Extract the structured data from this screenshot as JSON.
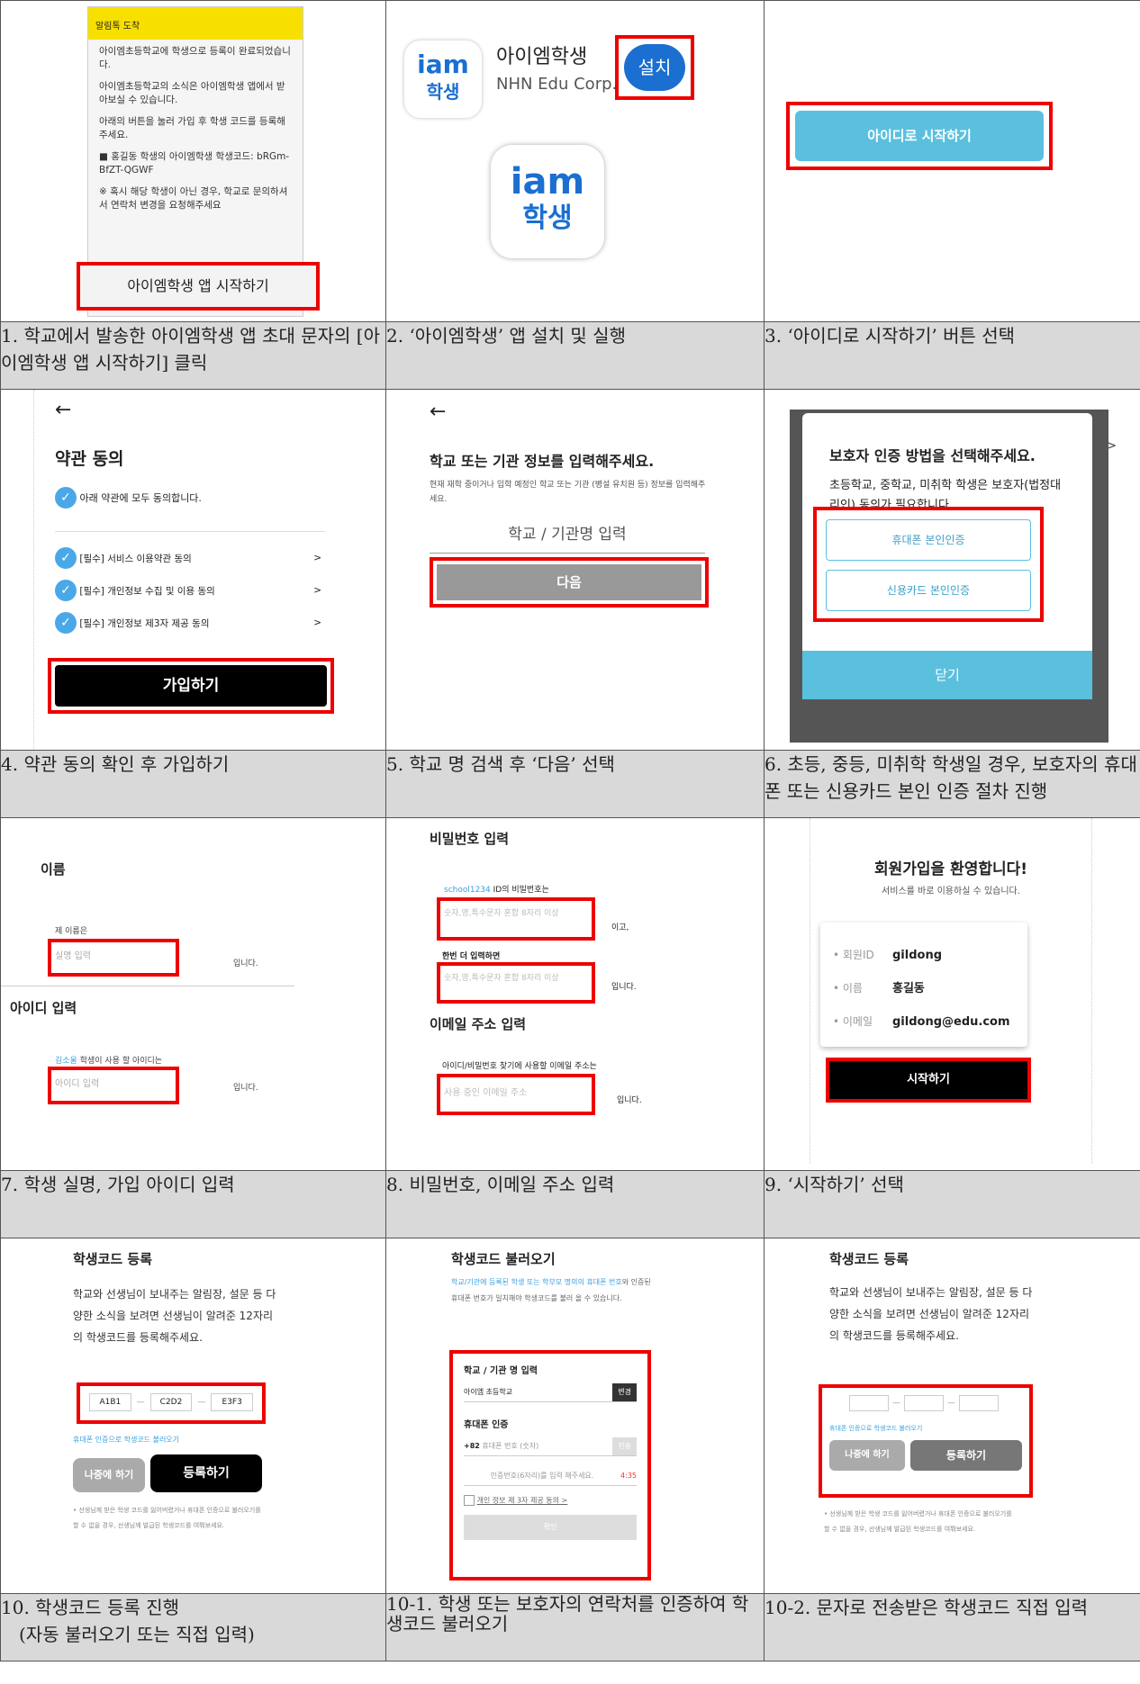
{
  "c1": {
    "header": "알림톡 도착",
    "p1": "아이엠초등학교에 학생으로 등록이 완료되었습니다.",
    "p2": "아이엠초등학교의 소식은 아이엠학생 앱에서 받아보실 수 있습니다.",
    "p3": "아래의 버튼을 눌러 가입 후 학생 코드를 등록해 주세요.",
    "p4": "■ 홍길동 학생의 아이엠학생 학생코드: bRGm-BfZT-QGWF",
    "p5": "※ 혹시 해당 학생이 아닌 경우, 학교로 문의하셔서 연락처 변경을 요청해주세요",
    "button": "아이엠학생 앱 시작하기"
  },
  "c2": {
    "logo_top": "iam",
    "logo_bottom": "학생",
    "app_name": "아이엠학생",
    "company": "NHN Edu Corp.",
    "install": "설치"
  },
  "c3": {
    "button": "아이디로 시작하기"
  },
  "cap1": {
    "c1": "1. 학교에서 발송한 아이엠학생 앱 초대 문자의 [아이엠학생 앱 시작하기] 클릭",
    "c2": "2. ‘아이엠학생’ 앱 설치 및 실행",
    "c3": "3. ‘아이디로 시작하기’ 버튼 선택"
  },
  "c4": {
    "back": "←",
    "title": "약관 동의",
    "all": "아래 약관에 모두 동의합니다.",
    "t1": "[필수] 서비스 이용약관 동의",
    "t2": "[필수] 개인정보 수집 및 이용 동의",
    "t3": "[필수] 개인정보 제3자 제공 동의",
    "chev": ">",
    "button": "가입하기"
  },
  "c5": {
    "back": "←",
    "title": "학교 또는 기관 정보를 입력해주세요.",
    "sub": "현재 재학 중이거나 입학 예정인 학교 또는 기관 (병설 유치원 등) 정보를 입력해주세요.",
    "input": "학교 / 기관명 입력",
    "button": "다음"
  },
  "c6": {
    "title": "보호자 인증 방법을 선택해주세요.",
    "sub": "초등학교, 중학교, 미취학 학생은 보호자(법정대리인) 동의가 필요합니다.",
    "phone": "휴대폰 본인인증",
    "card": "신용카드 본인인증",
    "close": "닫기",
    "chev": ">"
  },
  "cap2": {
    "c1": "4. 약관 동의 확인 후 가입하기",
    "c2": "5. 학교 명 검색 후 ‘다음’ 선택",
    "c3": "6. 초등, 중등, 미취학 학생일 경우, 보호자의 휴대폰 또는 신용카드 본인 인증 절차 진행"
  },
  "c7": {
    "name_title": "이름",
    "name_label": "제 이름은",
    "name_ph": "실명 입력",
    "suffix": "입니다.",
    "id_title": "아이디 입력",
    "id_label_name": "김소울",
    "id_label": " 학생이 사용 할 아이디는",
    "id_ph": "아이디 입력"
  },
  "c8": {
    "title": "비밀번호 입력",
    "id_hint_id": "school1234",
    "id_hint": " ID의 비밀번호는",
    "pw_ph": "숫자,영,특수문자 혼합 8자리 이상",
    "mid": "이고,",
    "again": "한번 더 입력하면",
    "suffix": "입니다.",
    "email_title": "이메일 주소 입력",
    "email_label": "아이디/비밀번호 찾기에 사용할 이메일 주소는",
    "email_ph": "사용 중인 이메일 주소"
  },
  "c9": {
    "title": "회원가입을 환영합니다!",
    "sub": "서비스를 바로 이용하실 수 있습니다.",
    "k1": "• 회원ID",
    "v1": "gildong",
    "k2": "• 이름",
    "v2": "홍길동",
    "k3": "• 이메일",
    "v3": "gildong@edu.com",
    "button": "시작하기"
  },
  "cap3": {
    "c1": "7. 학생 실명, 가입 아이디 입력",
    "c2": "8. 비밀번호, 이메일 주소 입력",
    "c3": "9. ‘시작하기’ 선택"
  },
  "c10": {
    "title": "학생코드 등록",
    "desc": "학교와 선생님이 보내주는 알림장, 설문 등 다양한 소식을 보려면 선생님이 알려준 12자리의 학생코드를 등록해주세요.",
    "code1": "A1B1",
    "code2": "C2D2",
    "code3": "E3F3",
    "dash": "—",
    "link": "휴대폰 인증으로 학생코드 불러오기",
    "later": "나중에 하기",
    "register": "등록하기",
    "note": "• 선생님께 받은 학생 코드를 잃어버렸거나 휴대폰 인증으로 불러오기를 할 수 없을 경우, 선생님께 발급된 학생코드를 여쭤보세요."
  },
  "c11": {
    "title": "학생코드 불러오기",
    "desc_a": "학교/기관에 등록된 학생 또는 학부모 명의의",
    "desc_b": "휴대폰 번호",
    "desc_c": "와 인증된 휴대폰 번호가 일치해야",
    "desc_d": "학생코드를 불러 올 수 있습니다.",
    "school_label": "학교 / 기관 명 입력",
    "school_val": "아이엠 초등학교",
    "change": "변경",
    "phone_label": "휴대폰 인증",
    "cc": "+82",
    "phone_ph": "휴대폰 번호 (숫자)",
    "send": "전송",
    "code_ph": "인증번호(6자리)를 입력 해주세요.",
    "timer": "4:35",
    "agree": "개인 정보 제 3자 제공 동의 >",
    "confirm": "확인"
  },
  "c12": {
    "title": "학생코드 등록",
    "desc": "학교와 선생님이 보내주는 알림장, 설문 등 다양한 소식을 보려면 선생님이 알려준 12자리의 학생코드를 등록해주세요.",
    "link": "휴대폰 인증으로 학생코드 불러오기",
    "later": "나중에 하기",
    "register": "등록하기",
    "note": "• 선생님께 받은 학생 코드를 잃어버렸거나 휴대폰 인증으로 불러오기를 할 수 없을 경우, 선생님께 발급된 학생코드를 여쭤보세요."
  },
  "cap4": {
    "c1a": "10. 학생코드 등록 진행",
    "c1b": "(자동 불러오기 또는 직접 입력)",
    "c2": "10-1. 학생 또는 보호자의 연락처를 인증하여 학생코드 불러오기",
    "c3": "10-2. 문자로 전송받은 학생코드 직접 입력"
  }
}
